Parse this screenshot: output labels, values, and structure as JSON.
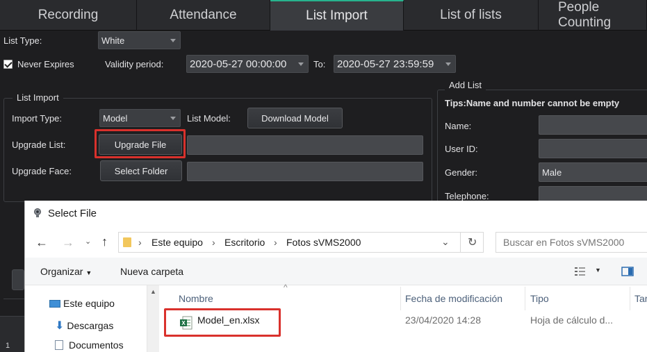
{
  "tabs": [
    {
      "label": "Recording"
    },
    {
      "label": "Attendance"
    },
    {
      "label": "List Import"
    },
    {
      "label": "List of lists"
    },
    {
      "label": "People Counting"
    }
  ],
  "form": {
    "list_type_label": "List Type:",
    "list_type_value": "White",
    "never_expires_label": "Never Expires",
    "validity_label": "Validity period:",
    "validity_from": "2020-05-27 00:00:00",
    "to_label": "To:",
    "validity_to": "2020-05-27 23:59:59"
  },
  "list_import": {
    "group_title": "List Import",
    "import_type_label": "Import Type:",
    "import_type_value": "Model",
    "list_model_label": "List Model:",
    "download_model_button": "Download Model",
    "upgrade_list_label": "Upgrade List:",
    "upgrade_file_button": "Upgrade File",
    "upgrade_face_label": "Upgrade Face:",
    "select_folder_button": "Select Folder"
  },
  "add_list": {
    "group_title": "Add List",
    "tips": "Tips:Name and number cannot be empty",
    "name_label": "Name:",
    "user_id_label": "User ID:",
    "gender_label": "Gender:",
    "gender_value": "Male",
    "telephone_label": "Telephone:"
  },
  "grid": {
    "row_number": "1"
  },
  "dialog": {
    "title": "Select File",
    "breadcrumb": [
      "Este equipo",
      "Escritorio",
      "Fotos sVMS2000"
    ],
    "search_placeholder": "Buscar en Fotos sVMS2000",
    "organize_label": "Organizar",
    "new_folder_label": "Nueva carpeta",
    "nav_items": [
      {
        "label": "Este equipo",
        "icon": "computer-icon"
      },
      {
        "label": "Descargas",
        "icon": "download-icon"
      },
      {
        "label": "Documentos",
        "icon": "documents-icon"
      }
    ],
    "columns": [
      "Nombre",
      "Fecha de modificación",
      "Tipo",
      "Tar"
    ],
    "files": [
      {
        "name": "Model_en.xlsx",
        "modified": "23/04/2020 14:28",
        "type": "Hoja de cálculo d...",
        "icon": "excel-icon"
      }
    ]
  },
  "colors": {
    "accent": "#27b38e",
    "highlight": "#d9312c",
    "excel": "#1e7145"
  }
}
